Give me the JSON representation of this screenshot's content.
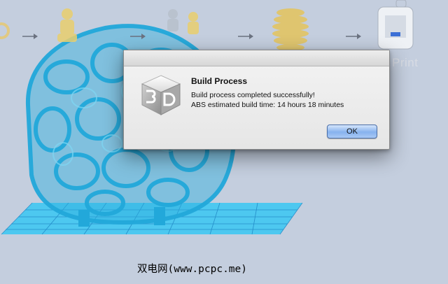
{
  "toolbar": {
    "steps": [
      {
        "name": "import",
        "icon": "ring-model-icon"
      },
      {
        "name": "orient",
        "icon": "figure-model-icon"
      },
      {
        "name": "arrange",
        "icon": "multiple-figures-icon"
      },
      {
        "name": "slice",
        "icon": "sliced-model-icon"
      },
      {
        "name": "print",
        "icon": "printer-icon",
        "label": "Print"
      }
    ],
    "arrow_icon": "arrow-right-icon"
  },
  "viewport": {
    "model_icon": "lattice-model-icon",
    "model_color": "#33b4e0",
    "platform_color": "#3fc7f3"
  },
  "dialog": {
    "title": "Build Process",
    "icon": "app-3d-logo-icon",
    "message_line1": "Build process completed successfully!",
    "message_line2": "ABS estimated build time: 14 hours 18 minutes",
    "ok_label": "OK"
  },
  "watermark": "双电网(www.pcpc.me)"
}
